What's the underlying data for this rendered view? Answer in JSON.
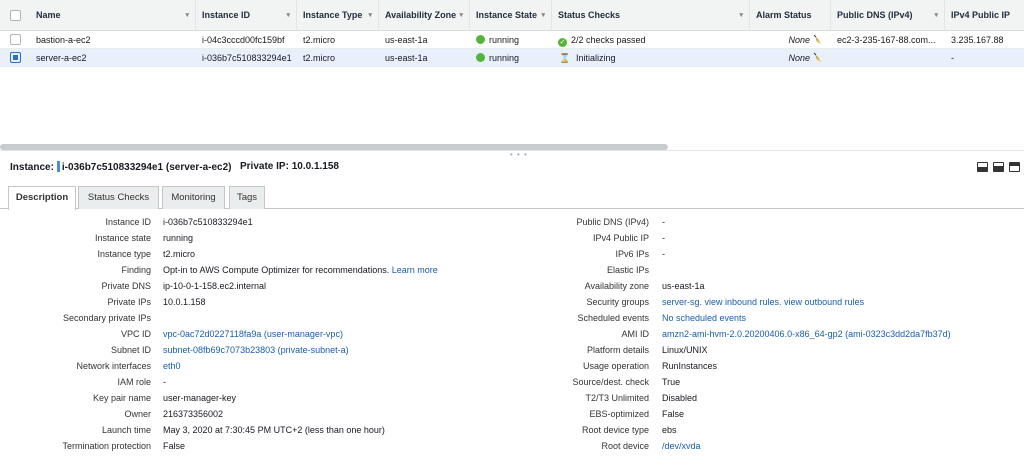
{
  "table": {
    "columns": [
      {
        "label": "Name",
        "sort": "▾"
      },
      {
        "label": "Instance ID",
        "sort": "▾"
      },
      {
        "label": "Instance Type",
        "sort": "▾"
      },
      {
        "label": "Availability Zone",
        "sort": "▾"
      },
      {
        "label": "Instance State",
        "sort": "▾"
      },
      {
        "label": "Status Checks",
        "sort": "▾"
      },
      {
        "label": "Alarm Status",
        "sort": ""
      },
      {
        "label": "Public DNS (IPv4)",
        "sort": "▾"
      },
      {
        "label": "IPv4 Public IP",
        "sort": ""
      }
    ],
    "rows": [
      {
        "name": "bastion-a-ec2",
        "instance_id": "i-04c3cccd00fc159bf",
        "instance_type": "t2.micro",
        "az": "us-east-1a",
        "state": "running",
        "status_checks": "2/2 checks passed",
        "alarm": "None",
        "public_dns": "ec2-3-235-167-88.com...",
        "public_ip": "3.235.167.88",
        "selected": false
      },
      {
        "name": "server-a-ec2",
        "instance_id": "i-036b7c510833294e1",
        "instance_type": "t2.micro",
        "az": "us-east-1a",
        "state": "running",
        "status_checks": "Initializing",
        "alarm": "None",
        "public_dns": "",
        "public_ip": "-",
        "selected": true
      }
    ]
  },
  "detail": {
    "instance_label": "Instance:",
    "instance_value": "i-036b7c510833294e1 (server-a-ec2)",
    "private_ip_label": "Private IP:",
    "private_ip_value": "10.0.1.158"
  },
  "tabs": [
    "Description",
    "Status Checks",
    "Monitoring",
    "Tags"
  ],
  "description": {
    "left": [
      {
        "label": "Instance ID",
        "value": "i-036b7c510833294e1"
      },
      {
        "label": "Instance state",
        "value": "running"
      },
      {
        "label": "Instance type",
        "value": "t2.micro"
      },
      {
        "label": "Finding",
        "value": "Opt-in to AWS Compute Optimizer for recommendations.",
        "link": "Learn more"
      },
      {
        "label": "Private DNS",
        "value": "ip-10-0-1-158.ec2.internal"
      },
      {
        "label": "Private IPs",
        "value": "10.0.1.158"
      },
      {
        "label": "Secondary private IPs",
        "value": ""
      },
      {
        "label": "VPC ID",
        "link": "vpc-0ac72d0227118fa9a (user-manager-vpc)"
      },
      {
        "label": "Subnet ID",
        "link": "subnet-08fb69c7073b23803 (private-subnet-a)"
      },
      {
        "label": "Network interfaces",
        "link": "eth0"
      },
      {
        "label": "IAM role",
        "value": "-"
      },
      {
        "label": "Key pair name",
        "value": "user-manager-key"
      },
      {
        "label": "Owner",
        "value": "216373356002"
      },
      {
        "label": "Launch time",
        "value": "May 3, 2020 at 7:30:45 PM UTC+2 (less than one hour)"
      },
      {
        "label": "Termination protection",
        "value": "False"
      }
    ],
    "right": [
      {
        "label": "Public DNS (IPv4)",
        "value": "-"
      },
      {
        "label": "IPv4 Public IP",
        "value": "-"
      },
      {
        "label": "IPv6 IPs",
        "value": "-"
      },
      {
        "label": "Elastic IPs",
        "value": ""
      },
      {
        "label": "Availability zone",
        "value": "us-east-1a"
      },
      {
        "label": "Security groups",
        "link": "server-sg. view inbound rules. view outbound rules"
      },
      {
        "label": "Scheduled events",
        "link": "No scheduled events"
      },
      {
        "label": "AMI ID",
        "link": "amzn2-ami-hvm-2.0.20200406.0-x86_64-gp2 (ami-0323c3dd2da7fb37d)"
      },
      {
        "label": "Platform details",
        "value": "Linux/UNIX"
      },
      {
        "label": "Usage operation",
        "value": "RunInstances"
      },
      {
        "label": "Source/dest. check",
        "value": "True"
      },
      {
        "label": "T2/T3 Unlimited",
        "value": "Disabled"
      },
      {
        "label": "EBS-optimized",
        "value": "False"
      },
      {
        "label": "Root device type",
        "value": "ebs"
      },
      {
        "label": "Root device",
        "link": "/dev/xvda"
      }
    ]
  },
  "icons": {
    "row_checkbox": "checkbox-icon",
    "running": "running-status-icon",
    "checks_passed": "check-passed-icon",
    "initializing": "hourglass-icon",
    "alarm": "alarm-bell-icon",
    "layouts": [
      "layout-bottom-icon",
      "layout-split-icon",
      "layout-top-icon"
    ]
  },
  "colors": {
    "link": "#1a5da8",
    "running": "#55b33b",
    "selected_row": "#e7f0fb",
    "header_bg": "#f2f3f3"
  }
}
